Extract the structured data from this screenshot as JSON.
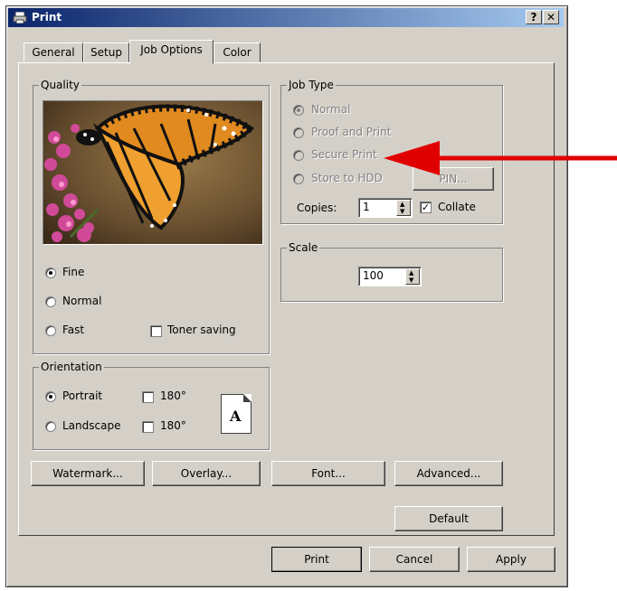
{
  "window": {
    "title": "Print",
    "help_label": "?",
    "close_label": "✕"
  },
  "tabs": [
    {
      "label": "General"
    },
    {
      "label": "Setup"
    },
    {
      "label": "Job Options",
      "active": true
    },
    {
      "label": "Color"
    }
  ],
  "quality": {
    "legend": "Quality",
    "options": [
      {
        "label": "Fine",
        "selected": true
      },
      {
        "label": "Normal",
        "selected": false
      },
      {
        "label": "Fast",
        "selected": false
      }
    ],
    "toner_saving_label": "Toner saving",
    "toner_saving_checked": false
  },
  "orientation": {
    "legend": "Orientation",
    "portrait_label": "Portrait",
    "landscape_label": "Landscape",
    "rotate_label_1": "180°",
    "rotate_label_2": "180°",
    "preview_letter": "A"
  },
  "job_type": {
    "legend": "Job Type",
    "options": [
      {
        "label": "Normal",
        "selected": true
      },
      {
        "label": "Proof and Print",
        "selected": false
      },
      {
        "label": "Secure Print",
        "selected": false
      },
      {
        "label": "Store to HDD",
        "selected": false
      }
    ],
    "pin_label": "PIN...",
    "copies_label": "Copies:",
    "copies_value": "1",
    "collate_label": "Collate",
    "collate_checked": true
  },
  "scale": {
    "legend": "Scale",
    "value": "100"
  },
  "buttons": {
    "watermark": "Watermark...",
    "overlay": "Overlay...",
    "font": "Font...",
    "advanced": "Advanced...",
    "default": "Default",
    "print": "Print",
    "cancel": "Cancel",
    "apply": "Apply"
  },
  "colors": {
    "arrow": "#e00000",
    "titlebar": "#0a246a"
  }
}
